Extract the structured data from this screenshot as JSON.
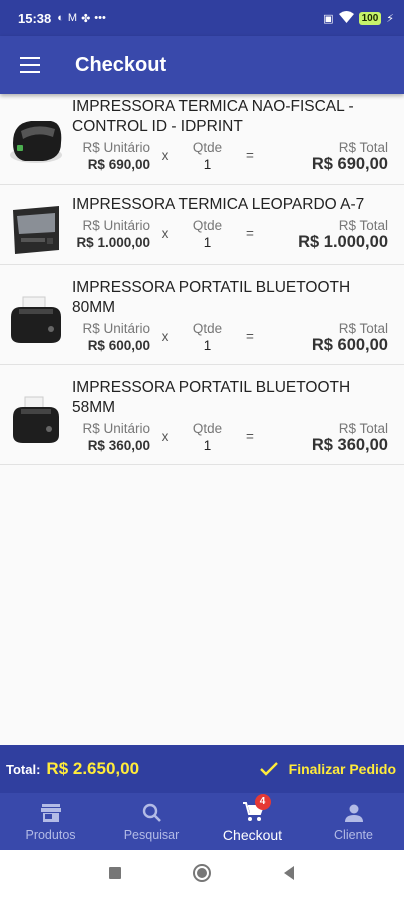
{
  "status_bar": {
    "time": "15:38",
    "battery": "100"
  },
  "app_bar": {
    "title": "Checkout"
  },
  "labels": {
    "unit": "R$ Unitário",
    "qty": "Qtde",
    "total": "R$ Total",
    "times": "x",
    "equals": "="
  },
  "items": [
    {
      "name": "IMPRESSORA TERMICA NAO-FISCAL - CONTROL ID - IDPRINT",
      "unit_price": "R$ 690,00",
      "qty": "1",
      "total": "R$ 690,00",
      "thumb": "round-printer"
    },
    {
      "name": "IMPRESSORA TERMICA LEOPARDO A-7",
      "unit_price": "R$ 1.000,00",
      "qty": "1",
      "total": "R$ 1.000,00",
      "thumb": "box-printer"
    },
    {
      "name": "IMPRESSORA PORTATIL BLUETOOTH 80MM",
      "unit_price": "R$ 600,00",
      "qty": "1",
      "total": "R$ 600,00",
      "thumb": "portable-printer"
    },
    {
      "name": "IMPRESSORA PORTATIL BLUETOOTH 58MM",
      "unit_price": "R$ 360,00",
      "qty": "1",
      "total": "R$ 360,00",
      "thumb": "portable-printer"
    }
  ],
  "footer": {
    "total_label": "Total:",
    "total_value": "R$ 2.650,00",
    "finalize_label": "Finalizar Pedido"
  },
  "bottom_nav": [
    {
      "label": "Produtos",
      "icon": "store-icon"
    },
    {
      "label": "Pesquisar",
      "icon": "search-icon"
    },
    {
      "label": "Checkout",
      "icon": "cart-icon",
      "badge": "4",
      "active": true
    },
    {
      "label": "Cliente",
      "icon": "person-icon"
    }
  ],
  "colors": {
    "primary": "#3949ab",
    "primary_dark": "#303f9f",
    "accent": "#ffeb3b",
    "badge": "#e53935"
  }
}
